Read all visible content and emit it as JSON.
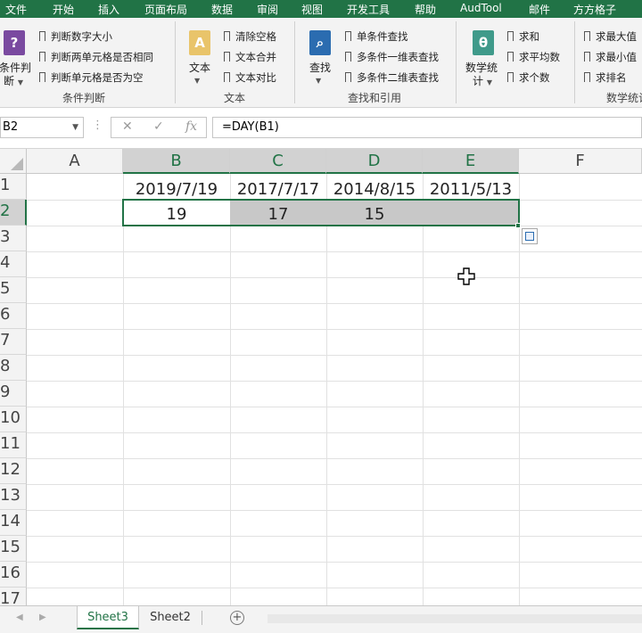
{
  "menu": [
    "文件",
    "开始",
    "插入",
    "页面布局",
    "数据",
    "审阅",
    "视图",
    "开发工具",
    "帮助",
    "AudTool",
    "邮件",
    "方方格子"
  ],
  "ribbon": {
    "groups": [
      {
        "big_label": "条件判断",
        "big_label2": "断",
        "items": [
          "判断数字大小",
          "判断两单元格是否相同",
          "判断单元格是否为空"
        ],
        "group_label": "条件判断"
      },
      {
        "big_label": "文本",
        "items": [
          "清除空格",
          "文本合并",
          "文本对比"
        ],
        "group_label": "文本"
      },
      {
        "big_label": "查找",
        "items": [
          "单条件查找",
          "多条件一维表查找",
          "多条件二维表查找"
        ],
        "group_label": "查找和引用"
      },
      {
        "big_label": "数学统",
        "big_label2": "计",
        "items": [
          "求和",
          "求平均数",
          "求个数"
        ],
        "group_label": ""
      },
      {
        "big_label": "",
        "items": [
          "求最大值",
          "求最小值",
          "求排名"
        ],
        "group_label": "数学统计"
      }
    ],
    "big_label_partial": "条件判"
  },
  "formula_bar": {
    "name_box": "B2",
    "fx": "fx",
    "formula": "=DAY(B1)"
  },
  "columns": [
    "A",
    "B",
    "C",
    "D",
    "E",
    "F"
  ],
  "rows": [
    "1",
    "2",
    "3",
    "4",
    "5",
    "6",
    "7",
    "8",
    "9",
    "10",
    "11",
    "12",
    "13",
    "14",
    "15",
    "16",
    "17"
  ],
  "cells": {
    "B1": "2019/7/19",
    "C1": "2017/7/17",
    "D1": "2014/8/15",
    "E1": "2011/5/13",
    "B2": "19",
    "C2": "17",
    "D2": "15"
  },
  "sheets": [
    "Sheet3",
    "Sheet2"
  ],
  "active_sheet": "Sheet3",
  "colors": {
    "accent": "#217346",
    "selection_fill": "#c8c8c8"
  }
}
